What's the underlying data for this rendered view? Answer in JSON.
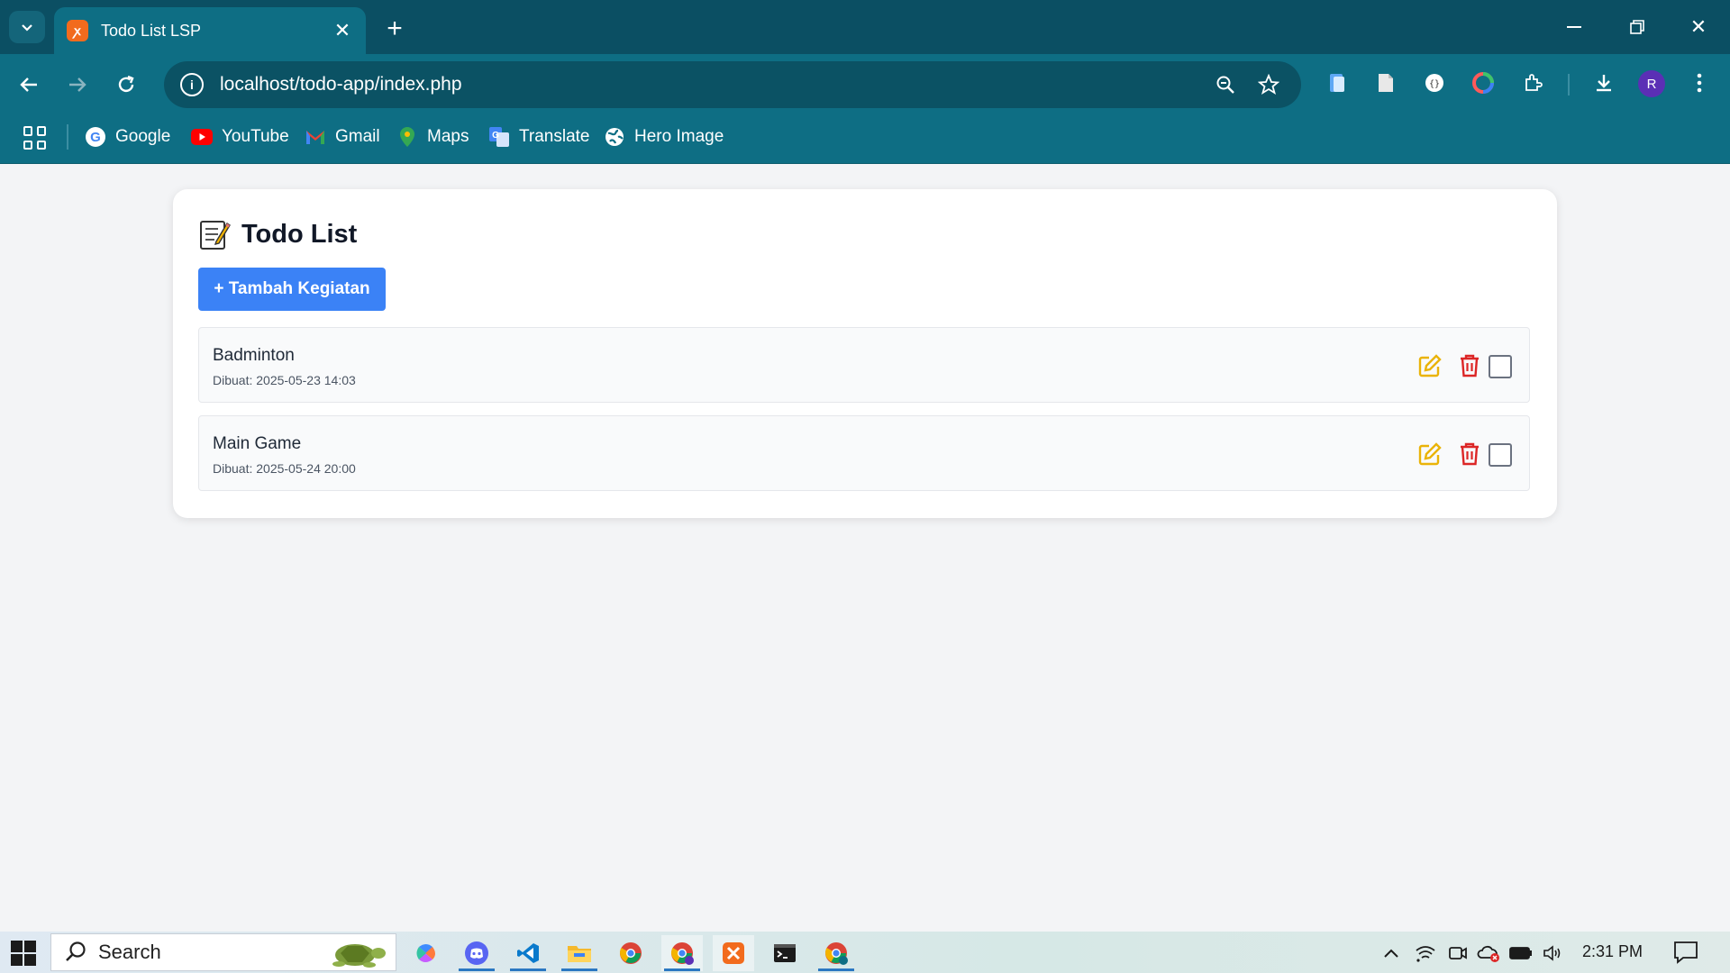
{
  "browser": {
    "tab_title": "Todo List LSP",
    "url": "localhost/todo-app/index.php",
    "profile_initial": "R"
  },
  "bookmarks": [
    {
      "label": "Google",
      "icon": "google-icon"
    },
    {
      "label": "YouTube",
      "icon": "youtube-icon"
    },
    {
      "label": "Gmail",
      "icon": "gmail-icon"
    },
    {
      "label": "Maps",
      "icon": "maps-icon"
    },
    {
      "label": "Translate",
      "icon": "translate-icon"
    },
    {
      "label": "Hero Image",
      "icon": "globe-icon"
    }
  ],
  "page": {
    "title": "Todo List",
    "add_button": "+ Tambah Kegiatan",
    "todos": [
      {
        "title": "Badminton",
        "created": "Dibuat: 2025-05-23 14:03",
        "done": false
      },
      {
        "title": "Main Game",
        "created": "Dibuat: 2025-05-24 20:00",
        "done": false
      }
    ]
  },
  "taskbar": {
    "search_label": "Search",
    "time": "2:31 PM"
  },
  "colors": {
    "chrome_dark": "#0b4f63",
    "chrome": "#0e6e84",
    "primary_button": "#3b82f6",
    "edit_icon": "#eab308",
    "delete_icon": "#dc2626"
  }
}
